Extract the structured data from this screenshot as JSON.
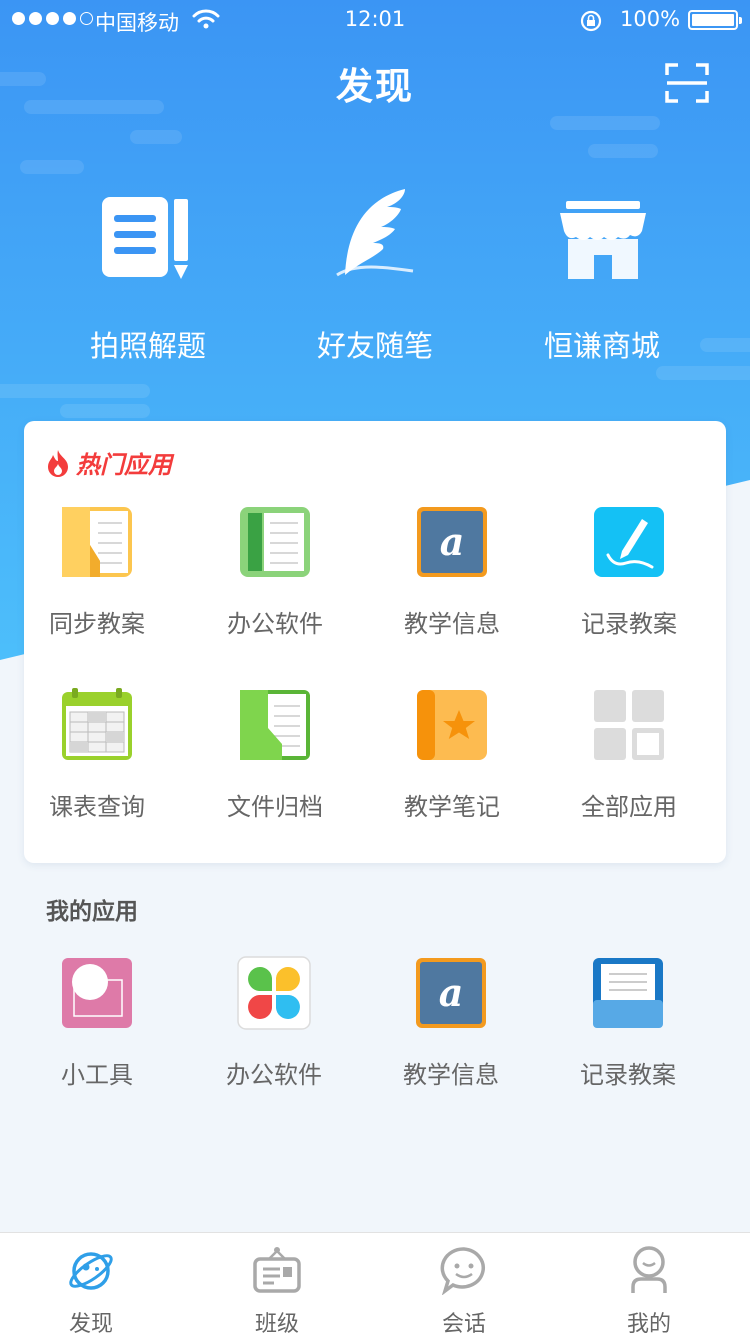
{
  "status_bar": {
    "carrier": "中国移动",
    "time": "12:01",
    "battery": "100%"
  },
  "header": {
    "title": "发现",
    "scan_icon": "scan-icon"
  },
  "features": [
    {
      "label": "拍照解题",
      "icon": "photo-solve-icon"
    },
    {
      "label": "好友随笔",
      "icon": "feather-icon"
    },
    {
      "label": "恒谦商城",
      "icon": "store-icon"
    }
  ],
  "hot_apps": {
    "title": "热门应用",
    "items": [
      {
        "label": "同步教案",
        "icon": "folder-notebook-icon"
      },
      {
        "label": "办公软件",
        "icon": "green-book-icon"
      },
      {
        "label": "教学信息",
        "icon": "letter-a-icon"
      },
      {
        "label": "记录教案",
        "icon": "pen-note-icon"
      },
      {
        "label": "课表查询",
        "icon": "calendar-grid-icon"
      },
      {
        "label": "文件归档",
        "icon": "green-file-icon"
      },
      {
        "label": "教学笔记",
        "icon": "star-notebook-icon"
      },
      {
        "label": "全部应用",
        "icon": "all-apps-icon"
      }
    ]
  },
  "my_apps": {
    "title": "我的应用",
    "items": [
      {
        "label": "小工具",
        "icon": "tools-icon"
      },
      {
        "label": "办公软件",
        "icon": "clover-icon"
      },
      {
        "label": "教学信息",
        "icon": "letter-a-icon"
      },
      {
        "label": "记录教案",
        "icon": "printer-doc-icon"
      }
    ]
  },
  "tab_bar": {
    "tabs": [
      {
        "label": "发现",
        "icon": "planet-icon",
        "active": true
      },
      {
        "label": "班级",
        "icon": "class-board-icon",
        "active": false
      },
      {
        "label": "会话",
        "icon": "chat-bubble-icon",
        "active": false
      },
      {
        "label": "我的",
        "icon": "user-icon",
        "active": false
      }
    ]
  },
  "colors": {
    "header_blue": "#3b95f4",
    "hot_red": "#f33c3c",
    "active_tab": "#2f9fe8",
    "inactive_tab": "#a9a9a9"
  }
}
